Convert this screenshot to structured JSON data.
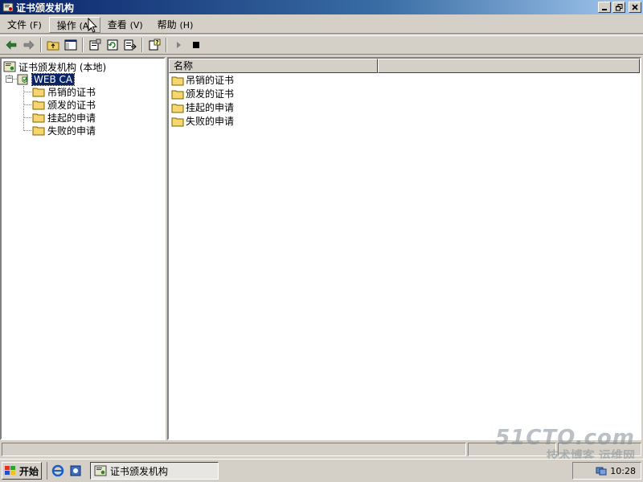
{
  "window": {
    "title": "证书颁发机构",
    "controls": [
      "minimize-icon",
      "restore-icon",
      "close-icon"
    ]
  },
  "menu": {
    "items": [
      {
        "label": "文件",
        "hotkey": "(F)"
      },
      {
        "label": "操作",
        "hotkey": "(A)"
      },
      {
        "label": "查看",
        "hotkey": "(V)"
      },
      {
        "label": "帮助",
        "hotkey": "(H)"
      }
    ]
  },
  "toolbar": {
    "icons": [
      "back-arrow-icon",
      "forward-arrow-icon",
      "up-folder-icon",
      "show-hide-tree-icon",
      "properties-icon",
      "refresh-icon",
      "export-list-icon",
      "help-icon",
      "start-service-icon",
      "stop-service-icon"
    ]
  },
  "tree": {
    "root": "证书颁发机构 (本地)",
    "ca": "WEB CA",
    "children": [
      "吊销的证书",
      "颁发的证书",
      "挂起的申请",
      "失败的申请"
    ]
  },
  "list": {
    "columns": [
      "名称",
      ""
    ],
    "items": [
      "吊销的证书",
      "颁发的证书",
      "挂起的申请",
      "失败的申请"
    ]
  },
  "taskbar": {
    "start_label": "开始",
    "task_label": "证书颁发机构",
    "clock": "10:28"
  },
  "watermark": {
    "line1": "51CTO.com",
    "line2": "技术博客",
    "line3": "运维网"
  }
}
